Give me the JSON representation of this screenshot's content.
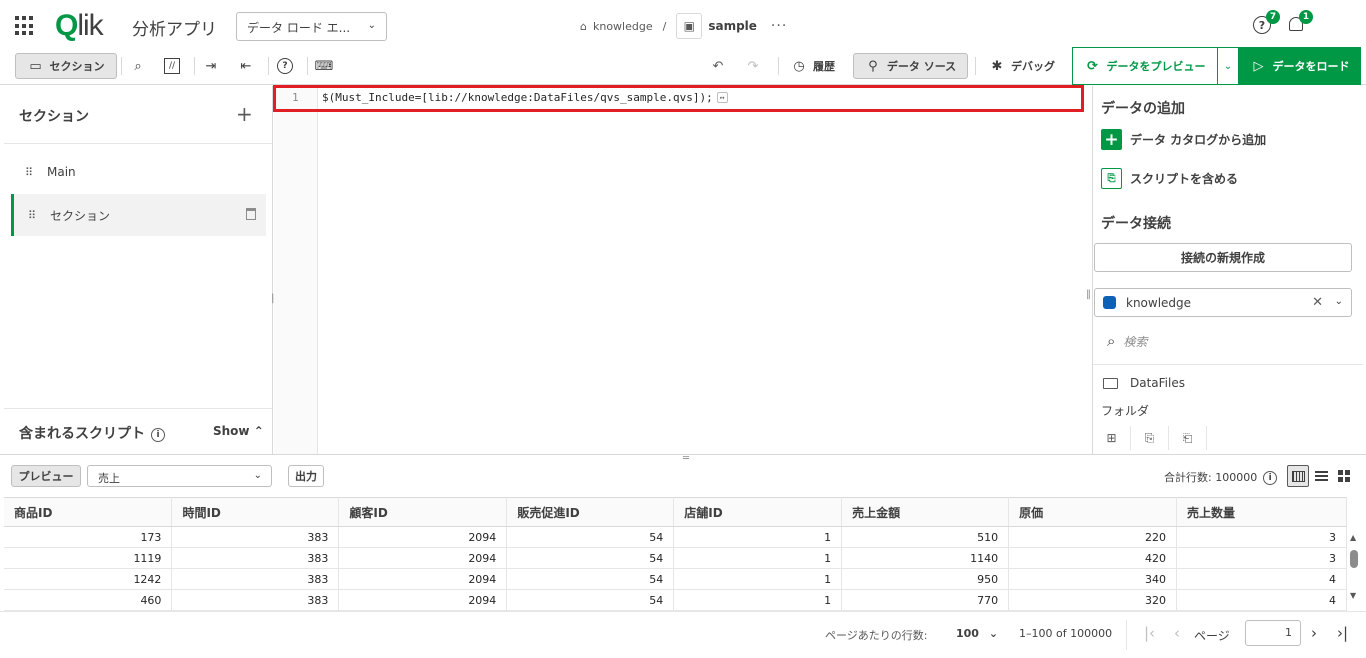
{
  "header": {
    "logo_q": "Q",
    "logo_rest": "lik",
    "app_name": "分析アプリ",
    "mode_dropdown": "データ ロード エ...",
    "breadcrumb_space": "knowledge",
    "breadcrumb_sep": "/",
    "breadcrumb_app": "sample",
    "more": "···",
    "help_badge": "7",
    "notif_badge": "1"
  },
  "toolbar": {
    "section": "セクション",
    "history": "履歴",
    "datasource": "データ ソース",
    "debug": "デバッグ",
    "preview_data": "データをプレビュー",
    "load_data": "データをロード"
  },
  "left": {
    "title": "セクション",
    "sections": [
      {
        "label": "Main"
      },
      {
        "label": "セクション"
      }
    ],
    "included_title": "含まれるスクリプト",
    "show": "Show"
  },
  "editor": {
    "line_no": "1",
    "code": "$(Must_Include=[lib://knowledge:DataFiles/qvs_sample.qvs]);"
  },
  "right": {
    "add_data_title": "データの追加",
    "add_from_catalog": "データ カタログから追加",
    "include_script": "スクリプトを含める",
    "connections_title": "データ接続",
    "new_connection": "接続の新規作成",
    "connection_name": "knowledge",
    "search_placeholder": "検索",
    "folder_name": "DataFiles",
    "folder_label": "フォルダ"
  },
  "preview": {
    "preview_btn": "プレビュー",
    "table_select": "売上",
    "output_btn": "出力",
    "total_rows": "合計行数: 100000"
  },
  "table": {
    "columns": [
      "商品ID",
      "時間ID",
      "顧客ID",
      "販売促進ID",
      "店舗ID",
      "売上金額",
      "原価",
      "売上数量"
    ],
    "rows": [
      [
        "173",
        "383",
        "2094",
        "54",
        "1",
        "510",
        "220",
        "3"
      ],
      [
        "1119",
        "383",
        "2094",
        "54",
        "1",
        "1140",
        "420",
        "3"
      ],
      [
        "1242",
        "383",
        "2094",
        "54",
        "1",
        "950",
        "340",
        "4"
      ],
      [
        "460",
        "383",
        "2094",
        "54",
        "1",
        "770",
        "320",
        "4"
      ]
    ]
  },
  "pager": {
    "rows_per_page_label": "ページあたりの行数:",
    "rows_per_page": "100",
    "range": "1–100 of 100000",
    "page_label": "ページ",
    "page": "1"
  },
  "colors": {
    "accent": "#009845",
    "highlight": "#e01e24",
    "connection": "#0d62b7"
  }
}
